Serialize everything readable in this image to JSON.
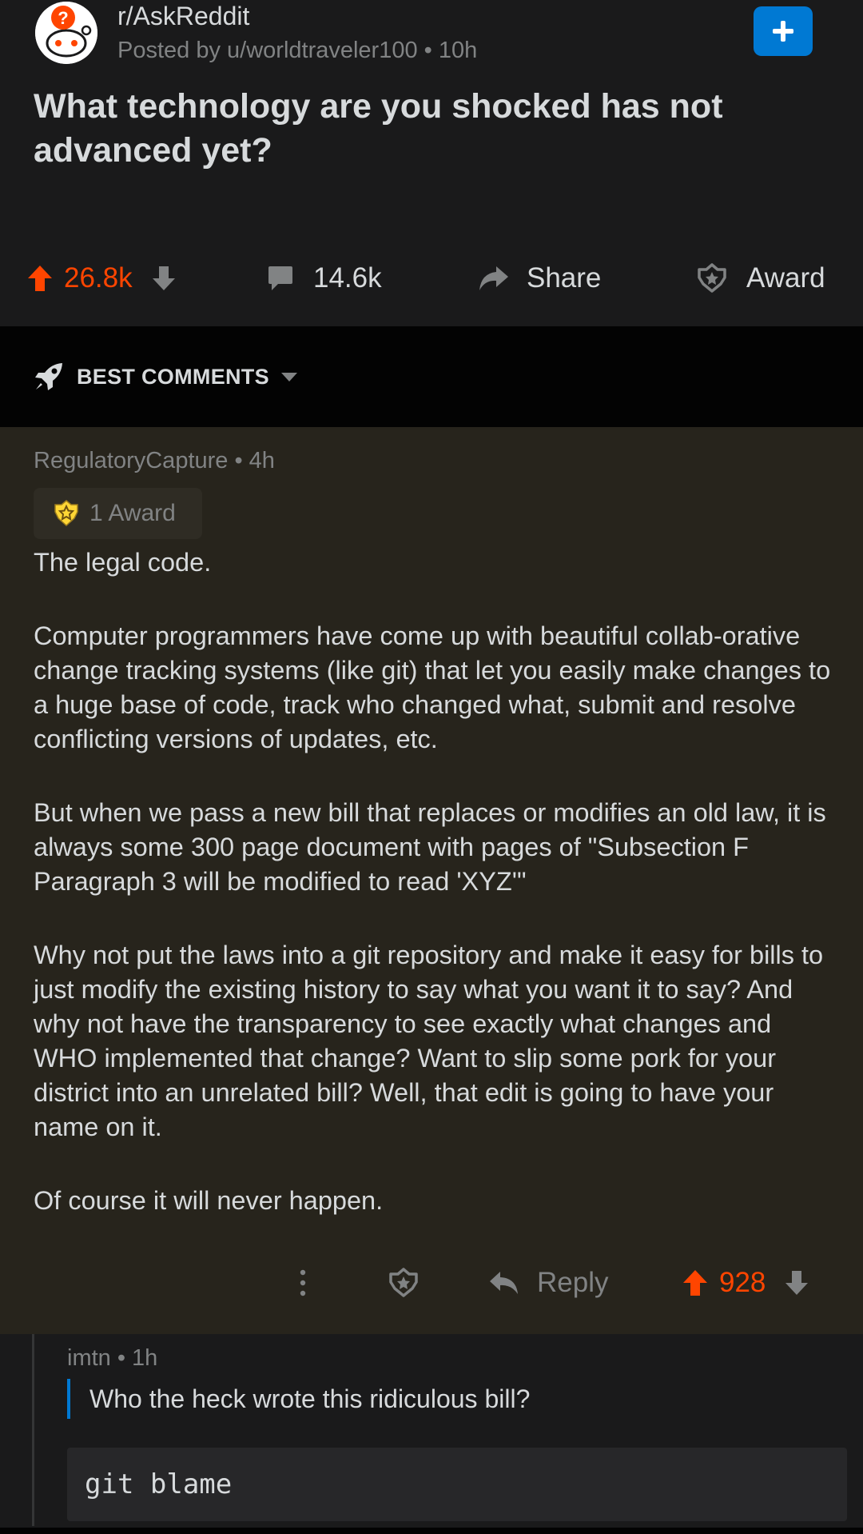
{
  "post": {
    "subreddit": "r/AskReddit",
    "posted_by": "Posted by u/worldtraveler100 • 10h",
    "title": "What technology are you shocked has not advanced yet?",
    "score": "26.8k",
    "comments_count": "14.6k",
    "share_label": "Share",
    "award_label": "Award",
    "icons": {
      "avatar": "askreddit-snoo-avatar",
      "join": "plus-icon",
      "upvote": "upvote-arrow-icon",
      "downvote": "downvote-arrow-icon",
      "comment": "comment-bubble-icon",
      "share": "share-arrow-icon",
      "award": "award-icon"
    },
    "colors": {
      "upvoted": "#ff4500",
      "accent": "#0079d3"
    }
  },
  "sort": {
    "label": "BEST COMMENTS",
    "icon": "rocket-icon"
  },
  "comment": {
    "meta": "RegulatoryCapture • 4h",
    "award_label": "1 Award",
    "paragraphs": [
      "The legal code.",
      "Computer programmers have come up with beautiful collab-orative change tracking systems (like git) that let you easily make changes to a huge base of code, track who changed what, submit and resolve conflicting versions of updates, etc.",
      "But when we pass a new bill that replaces or modifies an old law, it is always some 300 page document with pages of \"Subsection F Paragraph 3 will be modified to read 'XYZ'\"",
      "Why not put the laws into a git repository and make it easy for bills to just modify the existing history to say what you want it to say?  And why not have the transparency to see exactly what changes and WHO implemented that change?  Want to slip some pork for your district into an unrelated bill?  Well, that edit is going to have your name on it.",
      "Of course it will never happen."
    ],
    "reply_label": "Reply",
    "score": "928",
    "background": "#27241c"
  },
  "reply": {
    "meta": "imtn • 1h",
    "quote": "Who the heck wrote this ridiculous bill?",
    "code": "git blame"
  }
}
